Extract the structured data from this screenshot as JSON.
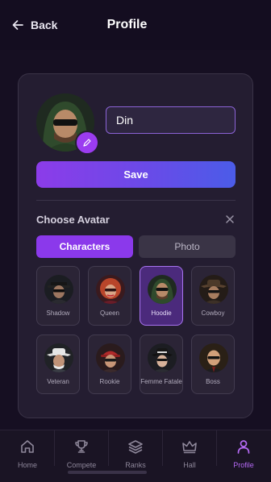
{
  "header": {
    "back_label": "Back",
    "title": "Profile"
  },
  "profile": {
    "name_value": "Din",
    "save_label": "Save"
  },
  "avatar_picker": {
    "heading": "Choose Avatar",
    "tabs": [
      {
        "label": "Characters",
        "active": true
      },
      {
        "label": "Photo",
        "active": false
      }
    ],
    "avatars": [
      {
        "label": "Shadow",
        "selected": false
      },
      {
        "label": "Queen",
        "selected": false
      },
      {
        "label": "Hoodie",
        "selected": true
      },
      {
        "label": "Cowboy",
        "selected": false
      },
      {
        "label": "Veteran",
        "selected": false
      },
      {
        "label": "Rookie",
        "selected": false
      },
      {
        "label": "Femme Fatale",
        "selected": false
      },
      {
        "label": "Boss",
        "selected": false
      }
    ]
  },
  "bottom_nav": {
    "items": [
      {
        "label": "Home",
        "icon": "home-icon",
        "active": false
      },
      {
        "label": "Compete",
        "icon": "trophy-icon",
        "active": false
      },
      {
        "label": "Ranks",
        "icon": "layers-icon",
        "active": false
      },
      {
        "label": "Hall",
        "icon": "crown-icon",
        "active": false
      },
      {
        "label": "Profile",
        "icon": "user-icon",
        "active": true
      }
    ]
  },
  "colors": {
    "accent": "#8b39eb",
    "background": "#160f22",
    "card": "#241d31"
  }
}
